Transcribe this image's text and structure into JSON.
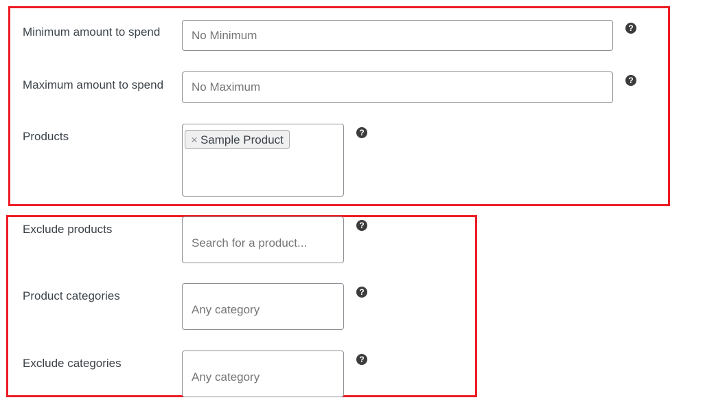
{
  "colors": {
    "highlight_border": "#ed1c24",
    "help_icon": "#3c3c3c"
  },
  "fields": [
    {
      "label": "Minimum amount to spend",
      "placeholder": "No Minimum"
    },
    {
      "label": "Maximum amount to spend",
      "placeholder": "No Maximum"
    },
    {
      "label": "Products",
      "selected": [
        {
          "label": "Sample Product",
          "remove": "×"
        }
      ]
    },
    {
      "label": "Exclude products",
      "placeholder": "Search for a product..."
    },
    {
      "label": "Product categories",
      "placeholder": "Any category"
    },
    {
      "label": "Exclude categories",
      "placeholder": "Any category"
    }
  ],
  "help_icon": {
    "name": "question-circle-icon",
    "glyph": "?"
  }
}
